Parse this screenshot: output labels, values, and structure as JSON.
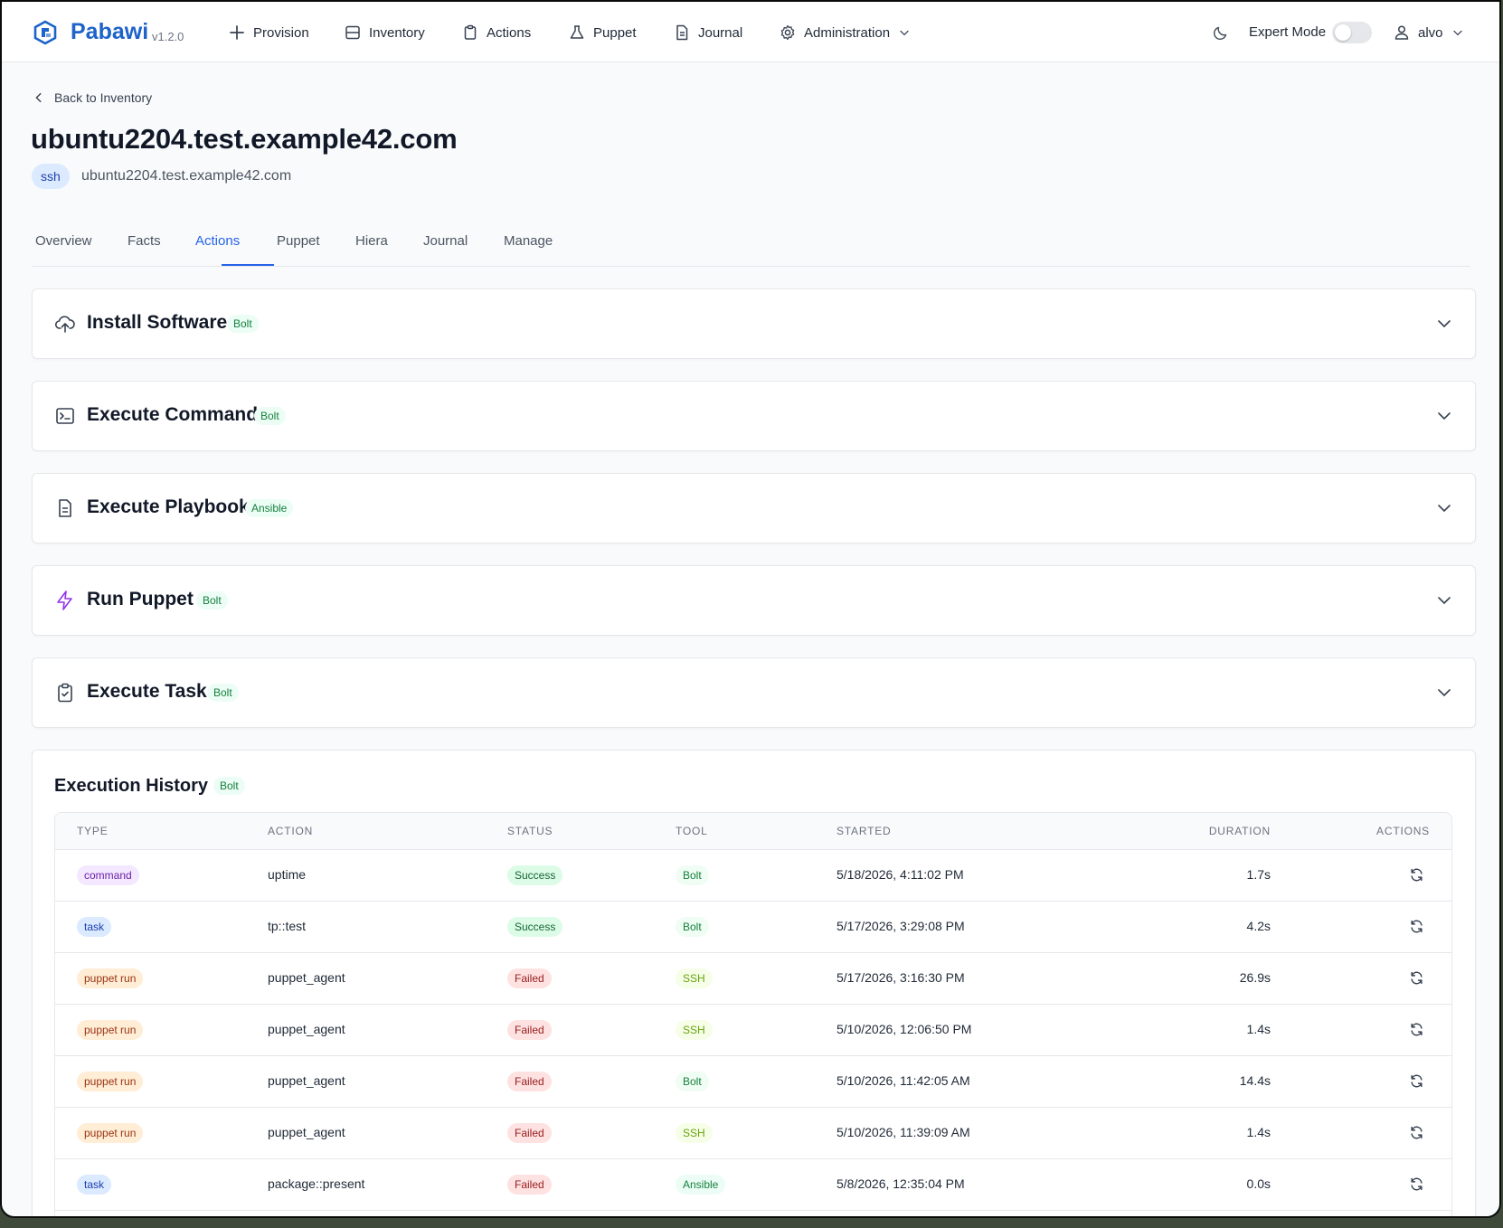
{
  "nav": {
    "brand": "Pabawi",
    "version": "v1.2.0",
    "items": [
      {
        "label": "Provision",
        "icon": "plus-icon"
      },
      {
        "label": "Inventory",
        "icon": "server-icon"
      },
      {
        "label": "Actions",
        "icon": "clipboard-icon"
      },
      {
        "label": "Puppet",
        "icon": "flask-icon"
      },
      {
        "label": "Journal",
        "icon": "document-icon"
      },
      {
        "label": "Administration",
        "icon": "gear-icon"
      }
    ],
    "expert_mode_label": "Expert Mode",
    "expert_mode_on": false,
    "user": "alvo"
  },
  "page": {
    "back_label": "Back to Inventory",
    "title": "ubuntu2204.test.example42.com",
    "transport_badge": "ssh",
    "hostname": "ubuntu2204.test.example42.com",
    "tabs": [
      "Overview",
      "Facts",
      "Actions",
      "Puppet",
      "Hiera",
      "Journal",
      "Manage"
    ],
    "active_tab": "Actions"
  },
  "actions": [
    {
      "name": "Install Software",
      "tag": "Bolt",
      "icon": "cloud-upload-icon"
    },
    {
      "name": "Execute Command",
      "tag": "Bolt",
      "icon": "terminal-icon"
    },
    {
      "name": "Execute Playbook",
      "tag": "Ansible",
      "icon": "document-icon"
    },
    {
      "name": "Run Puppet",
      "tag": "Bolt",
      "icon": "bolt-icon"
    },
    {
      "name": "Execute Task",
      "tag": "Bolt",
      "icon": "clipboard-check-icon"
    }
  ],
  "history": {
    "title": "Execution History",
    "tag": "Bolt",
    "columns": [
      "TYPE",
      "ACTION",
      "STATUS",
      "TOOL",
      "STARTED",
      "DURATION",
      "ACTIONS"
    ],
    "rows": [
      {
        "type": "command",
        "action": "uptime",
        "status": "Success",
        "tool": "Bolt",
        "started": "5/18/2026, 4:11:02 PM",
        "duration": "1.7s"
      },
      {
        "type": "task",
        "action": "tp::test",
        "status": "Success",
        "tool": "Bolt",
        "started": "5/17/2026, 3:29:08 PM",
        "duration": "4.2s"
      },
      {
        "type": "puppet run",
        "action": "puppet_agent",
        "status": "Failed",
        "tool": "SSH",
        "started": "5/17/2026, 3:16:30 PM",
        "duration": "26.9s"
      },
      {
        "type": "puppet run",
        "action": "puppet_agent",
        "status": "Failed",
        "tool": "SSH",
        "started": "5/10/2026, 12:06:50 PM",
        "duration": "1.4s"
      },
      {
        "type": "puppet run",
        "action": "puppet_agent",
        "status": "Failed",
        "tool": "Bolt",
        "started": "5/10/2026, 11:42:05 AM",
        "duration": "14.4s"
      },
      {
        "type": "puppet run",
        "action": "puppet_agent",
        "status": "Failed",
        "tool": "SSH",
        "started": "5/10/2026, 11:39:09 AM",
        "duration": "1.4s"
      },
      {
        "type": "task",
        "action": "package::present",
        "status": "Failed",
        "tool": "Ansible",
        "started": "5/8/2026, 12:35:04 PM",
        "duration": "0.0s"
      }
    ]
  },
  "colors": {
    "brand": "#1d63c9",
    "accent": "#2563eb",
    "success": "#166534",
    "failed": "#991b1b"
  }
}
